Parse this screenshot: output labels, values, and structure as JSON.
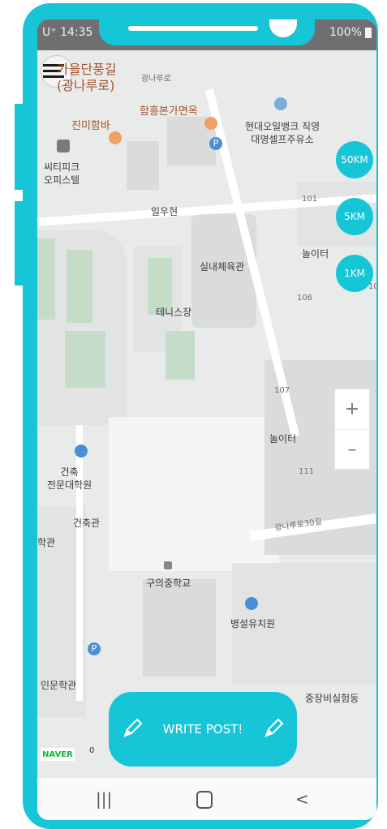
{
  "status_bar": {
    "carrier_time": "U⁺ 14:35",
    "battery": "100%"
  },
  "header": {
    "area_name": "가을단풍길\n(광나루로)"
  },
  "radius_options": [
    "50KM",
    "5KM",
    "1KM"
  ],
  "zoom": {
    "in": "+",
    "out": "–"
  },
  "map": {
    "labels": {
      "gwangnaru_ro": "광나루로",
      "hamheung": "함흥본가면옥",
      "jinmi": "진미함바",
      "hyundai_oil": "현대오일뱅크 직영\n대명셀프주유소",
      "ssitipark": "씨티피크\n오피스텔",
      "iluhyeon": "일우현",
      "bldg101": "101",
      "playground1": "놀이터",
      "indoor_gym": "실내체육관",
      "bldg106": "106",
      "bldg10x": "10",
      "tennis": "테니스장",
      "bldg107": "107",
      "playground2": "놀이터",
      "bldg111": "111",
      "arch_school": "건축\n전문대학원",
      "arch_hall": "건축관",
      "hakgwan": "학관",
      "gwangnaru_30": "광나루로30길",
      "guui_middle": "구의중학교",
      "byeongseol": "병설유치원",
      "inmun": "인문학관",
      "jungjang": "중장비실험동"
    }
  },
  "naver_logo": "NAVER",
  "scale_label": "0",
  "write_button": {
    "label": "WRITE POST!"
  },
  "nav_icons": [
    "recent-apps-icon",
    "home-icon",
    "back-icon"
  ],
  "colors": {
    "accent": "#16c6d6",
    "map_bg": "#e9ebea"
  }
}
